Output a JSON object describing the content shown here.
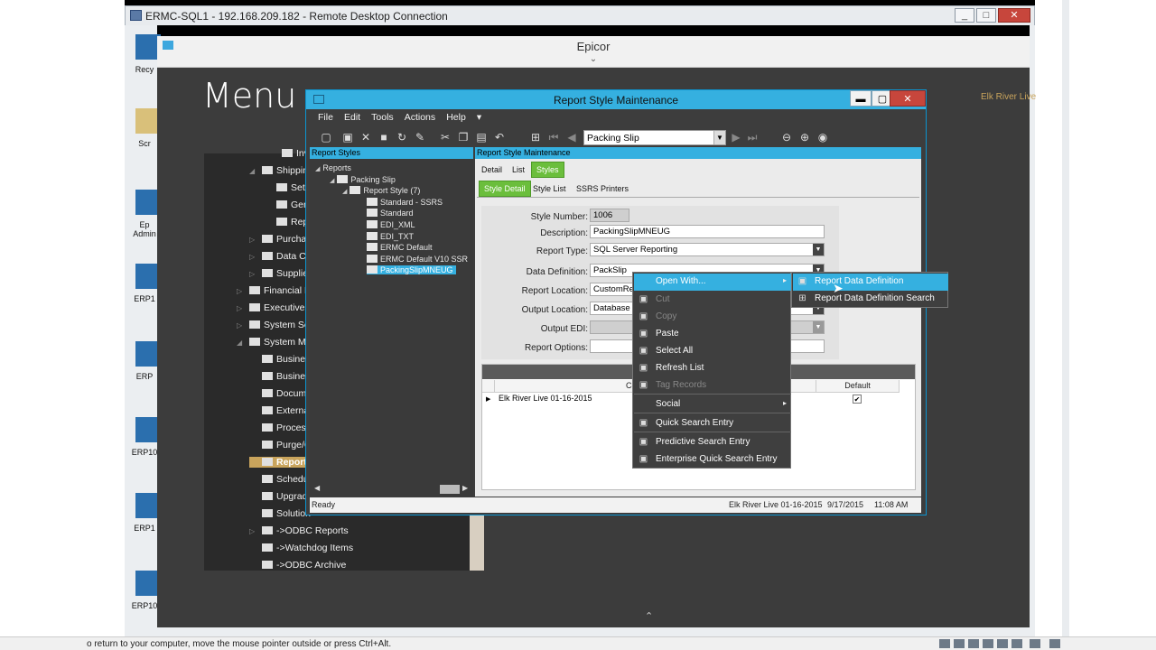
{
  "rdc": {
    "title": "ERMC-SQL1 - 192.168.209.182 - Remote Desktop Connection",
    "minimize": "_",
    "maximize": "□",
    "close": "✕"
  },
  "desktop_icons": [
    {
      "label": "Recy",
      "icon": "recycle-bin-icon"
    },
    {
      "label": "Scr",
      "icon": "folder-icon"
    },
    {
      "label": "Ep\nAdmin",
      "icon": "shortcut-icon"
    },
    {
      "label": "ERP1",
      "icon": "shortcut-icon"
    },
    {
      "label": "ERP",
      "icon": "shortcut-icon"
    },
    {
      "label": "ERP10",
      "icon": "shortcut-icon"
    },
    {
      "label": "ERP1",
      "icon": "shortcut-icon"
    },
    {
      "label": "ERP10",
      "icon": "shortcut-icon"
    }
  ],
  "epicor": {
    "title": "Epicor",
    "menu_heading": "Menu",
    "company": "Elk River Live"
  },
  "menu_tree": [
    {
      "label": "Inven",
      "arrow": ""
    },
    {
      "label": "Shippin",
      "arrow": "◢"
    },
    {
      "label": "Setu",
      "arrow": ""
    },
    {
      "label": "Gen",
      "arrow": ""
    },
    {
      "label": "Repo",
      "arrow": ""
    },
    {
      "label": "Purcha",
      "arrow": "▷"
    },
    {
      "label": "Data Co",
      "arrow": "▷"
    },
    {
      "label": "Supplie",
      "arrow": "▷"
    },
    {
      "label": "Financial M",
      "arrow": "▷"
    },
    {
      "label": "Executive A",
      "arrow": "▷"
    },
    {
      "label": "System Setu",
      "arrow": "▷"
    },
    {
      "label": "System Man",
      "arrow": "◢"
    },
    {
      "label": "Business",
      "arrow": ""
    },
    {
      "label": "Business",
      "arrow": ""
    },
    {
      "label": "Docume",
      "arrow": ""
    },
    {
      "label": "External",
      "arrow": ""
    },
    {
      "label": "Process",
      "arrow": ""
    },
    {
      "label": "Purge/C",
      "arrow": ""
    },
    {
      "label": "Report",
      "arrow": ""
    },
    {
      "label": "Schedul",
      "arrow": ""
    },
    {
      "label": "Upgrad",
      "arrow": ""
    },
    {
      "label": "Solution",
      "arrow": ""
    },
    {
      "label": "->ODBC Reports",
      "arrow": "▷"
    },
    {
      "label": "->Watchdog Items",
      "arrow": ""
    },
    {
      "label": "->ODBC Archive",
      "arrow": ""
    }
  ],
  "dialog": {
    "title": "Report Style Maintenance",
    "minimize": "▬",
    "maximize": "▢",
    "close": "✕",
    "menus": [
      "File",
      "Edit",
      "Tools",
      "Actions",
      "Help"
    ],
    "help_arrow": "▾",
    "nav_value": "Packing Slip",
    "left_header": "Report Styles",
    "right_header": "Report Style Maintenance",
    "left_tree": [
      "Reports",
      "Packing Slip",
      "Report Style (7)",
      "Standard - SSRS",
      "Standard",
      "EDI_XML",
      "EDI_TXT",
      "ERMC Default",
      "ERMC Default V10 SSR",
      "PackingSlipMNEUG"
    ],
    "tabs1": [
      "Detail",
      "List",
      "Styles"
    ],
    "tabs2": [
      "Style Detail",
      "Style List",
      "SSRS Printers"
    ],
    "fields": {
      "style_number_label": "Style Number:",
      "style_number": "1006",
      "description_label": "Description:",
      "description": "PackingSlipMNEUG",
      "report_type_label": "Report Type:",
      "report_type": "SQL Server Reporting",
      "data_definition_label": "Data Definition:",
      "data_definition": "PackSlip",
      "report_location_label": "Report Location:",
      "report_location": "CustomRe",
      "output_location_label": "Output Location:",
      "output_location": "Database",
      "output_edi_label": "Output EDI:",
      "output_edi": "",
      "report_options_label": "Report Options:",
      "report_options": ""
    },
    "grid": {
      "headers": [
        "Company Name",
        "Default"
      ],
      "row": {
        "company": "Elk River Live 01-16-2015",
        "default": "✔"
      },
      "row_marker": "▶"
    },
    "status": {
      "text": "Ready",
      "company": "Elk River Live 01-16-2015",
      "date": "9/17/2015",
      "time": "11:08 AM"
    }
  },
  "context_menu": {
    "items": [
      {
        "label": "Open With...",
        "icon": "",
        "state": "highlight",
        "sub": "▸"
      },
      {
        "label": "Cut",
        "icon": "scissors-icon",
        "state": "disabled"
      },
      {
        "label": "Copy",
        "icon": "copy-icon",
        "state": "disabled"
      },
      {
        "label": "Paste",
        "icon": "paste-icon",
        "state": "normal"
      },
      {
        "label": "Select All",
        "icon": "select-all-icon",
        "state": "normal"
      },
      {
        "label": "Refresh List",
        "icon": "refresh-icon",
        "state": "normal"
      },
      {
        "label": "Tag Records",
        "icon": "tag-icon",
        "state": "disabled"
      },
      {
        "label": "Social",
        "icon": "",
        "state": "normal",
        "sub": "▸"
      },
      {
        "label": "Quick Search Entry",
        "icon": "search-entry-icon",
        "state": "normal"
      },
      {
        "label": "Predictive Search Entry",
        "icon": "search-entry-icon",
        "state": "normal"
      },
      {
        "label": "Enterprise Quick Search Entry",
        "icon": "search-entry-icon",
        "state": "normal"
      }
    ],
    "submenu": [
      {
        "label": "Report Data Definition",
        "icon": "entry-icon",
        "state": "highlight"
      },
      {
        "label": "Report Data Definition Search",
        "icon": "binoculars-icon",
        "state": "normal"
      }
    ]
  },
  "bottom_bar": {
    "text": "o return to your computer, move the mouse pointer outside or press Ctrl+Alt."
  }
}
